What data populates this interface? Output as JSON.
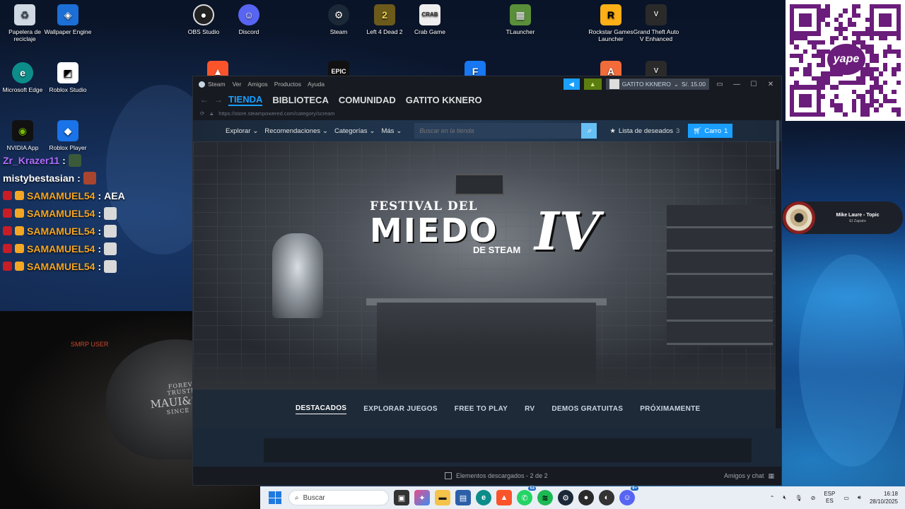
{
  "desktop": {
    "icons": [
      {
        "label": "Papelera de reciclaje",
        "icon": "recycle-bin-icon"
      },
      {
        "label": "Wallpaper Engine",
        "icon": "wallpaper-engine-icon"
      },
      {
        "label": "OBS Studio",
        "icon": "obs-icon"
      },
      {
        "label": "Discord",
        "icon": "discord-icon"
      },
      {
        "label": "Steam",
        "icon": "steam-icon"
      },
      {
        "label": "Left 4 Dead 2",
        "icon": "l4d2-icon"
      },
      {
        "label": "Crab Game",
        "icon": "crab-game-icon"
      },
      {
        "label": "TLauncher",
        "icon": "tlauncher-icon"
      },
      {
        "label": "Rockstar Games Launcher",
        "icon": "rockstar-icon"
      },
      {
        "label": "Grand Theft Auto V Enhanced",
        "icon": "gta-icon"
      },
      {
        "label": "Microsoft Edge",
        "icon": "edge-icon"
      },
      {
        "label": "Roblox Studio",
        "icon": "roblox-studio-icon"
      },
      {
        "label": "NVIDIA App",
        "icon": "nvidia-icon"
      },
      {
        "label": "Roblox Player",
        "icon": "roblox-player-icon"
      },
      {
        "label": "EPIC",
        "icon": "epic-icon"
      }
    ]
  },
  "chat": {
    "messages": [
      {
        "user": "Zr_Krazer11",
        "sep": " :",
        "text": "",
        "color": "#b16cff"
      },
      {
        "user": "mistybestasian",
        "sep": " :",
        "text": "",
        "color": "#ffffff"
      },
      {
        "user": "SAMAMUEL54",
        "sep": " :",
        "text": " AEA",
        "color": "#f5a623"
      },
      {
        "user": "SAMAMUEL54",
        "sep": " :",
        "text": "",
        "color": "#f5a623"
      },
      {
        "user": "SAMAMUEL54",
        "sep": " :",
        "text": "",
        "color": "#f5a623"
      },
      {
        "user": "SAMAMUEL54",
        "sep": " :",
        "text": "",
        "color": "#f5a623"
      },
      {
        "user": "SAMAMUEL54",
        "sep": " :",
        "text": "",
        "color": "#f5a623"
      }
    ]
  },
  "webcam": {
    "overlay_text": "SMRP USER",
    "cap_line1": "FOREVER TRUSTING",
    "cap_line2": "MAUI&SONS",
    "cap_line3": "SINCE 1980"
  },
  "qr": {
    "brand": "yape"
  },
  "music": {
    "title": "Mike Laure - Topic",
    "subtitle": "El Zapato"
  },
  "steam": {
    "top_menu": [
      "Steam",
      "Ver",
      "Amigos",
      "Productos",
      "Ayuda"
    ],
    "user": "GATITO KKNERO",
    "balance": "S/. 15.00",
    "nav": [
      "TIENDA",
      "BIBLIOTECA",
      "COMUNIDAD",
      "GATITO KKNERO"
    ],
    "url": "https://store.steampowered.com/category/scream",
    "store_menu": [
      "Explorar",
      "Recomendaciones",
      "Categorías",
      "Más"
    ],
    "search_placeholder": "Buscar en la tienda",
    "wishlist_label": "Lista de deseados",
    "wishlist_count": "3",
    "cart_label": "Carro",
    "cart_count": "1",
    "banner": {
      "line1": "FESTIVAL DEL",
      "line2": "MIEDO",
      "line3": "DE STEAM",
      "numeral": "IV"
    },
    "tabs": [
      "DESTACADOS",
      "EXPLORAR JUEGOS",
      "FREE TO PLAY",
      "RV",
      "DEMOS GRATUITAS",
      "PRÓXIMAMENTE"
    ],
    "downloads": "Elementos descargados - 2 de 2",
    "friends": "Amigos y chat"
  },
  "taskbar": {
    "search_placeholder": "Buscar",
    "whatsapp_badge": "53",
    "discord_badge": "9+",
    "lang1": "ESP",
    "lang2": "ES",
    "time": "16:18",
    "date": "28/10/2025"
  }
}
